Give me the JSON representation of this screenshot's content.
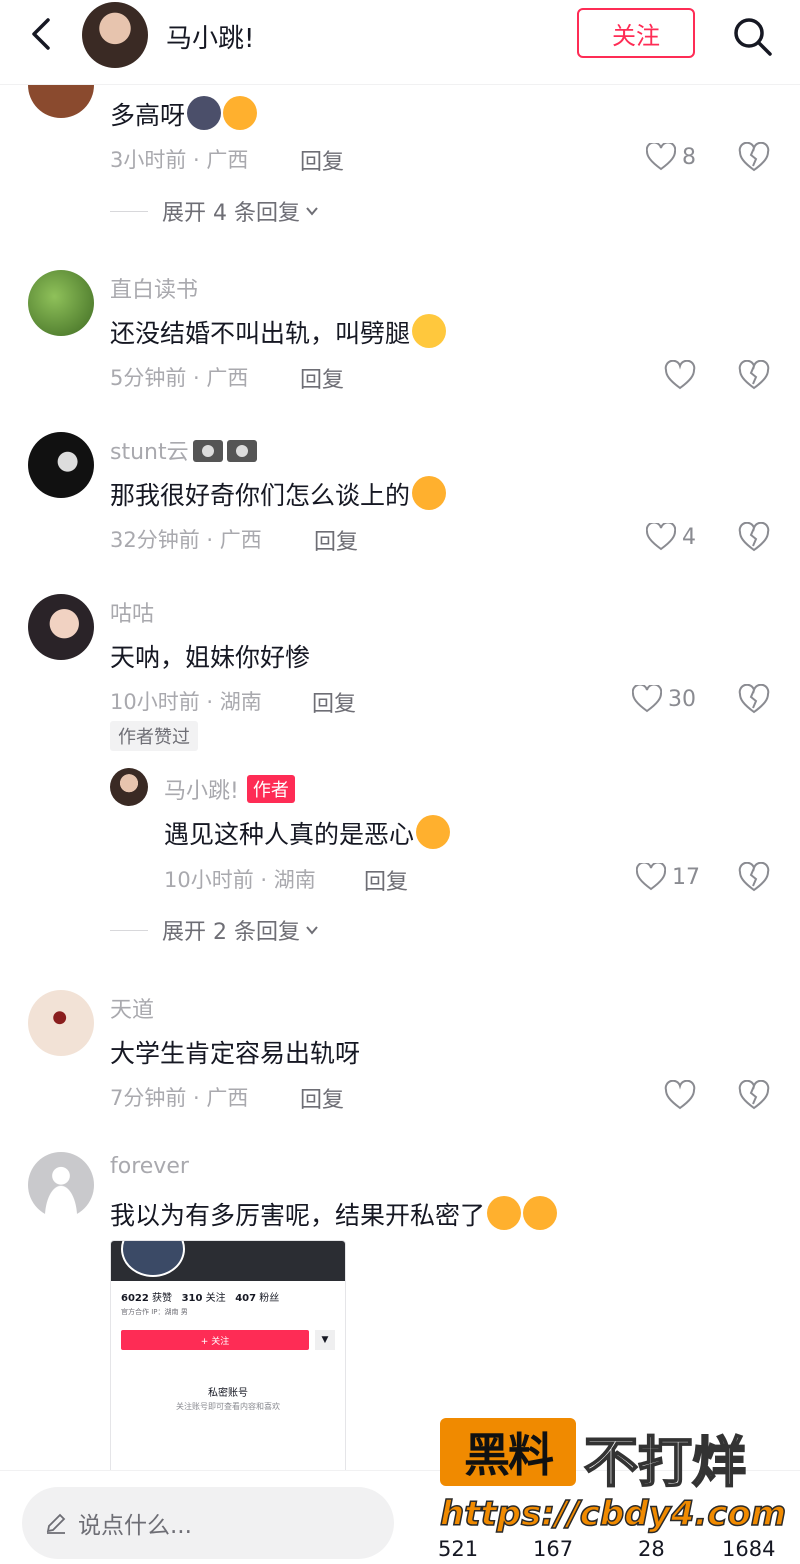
{
  "header": {
    "name": "马小跳!",
    "follow_label": "关注"
  },
  "comments": [
    {
      "text": "多高呀",
      "meta": "3小时前 · 广西",
      "reply": "回复",
      "likes": "8",
      "expand": "展开 4 条回复"
    },
    {
      "user": "直白读书",
      "text": "还没结婚不叫出轨，叫劈腿",
      "meta": "5分钟前 · 广西",
      "reply": "回复"
    },
    {
      "user": "stunt云",
      "text": "那我很好奇你们怎么谈上的",
      "meta": "32分钟前 · 广西",
      "reply": "回复",
      "likes": "4"
    },
    {
      "user": "咕咕",
      "text": "天呐，姐妹你好惨",
      "meta": "10小时前 · 湖南",
      "reply": "回复",
      "likes": "30",
      "badge": "作者赞过"
    },
    {
      "user": "马小跳!",
      "author_badge": "作者",
      "text": "遇见这种人真的是恶心",
      "meta": "10小时前 · 湖南",
      "reply": "回复",
      "likes": "17",
      "expand": "展开 2 条回复"
    },
    {
      "user": "天道",
      "text": "大学生肯定容易出轨呀",
      "meta": "7分钟前 · 广西",
      "reply": "回复"
    },
    {
      "user": "forever",
      "text": "我以为有多厉害呢，结果开私密了"
    }
  ],
  "thumb": {
    "stats": [
      "6022",
      "获赞",
      "310",
      "关注",
      "407",
      "粉丝"
    ],
    "tags": "官方合作  IP：湖南  男",
    "follow": "+ 关注",
    "dropdown": "▼",
    "private_title": "私密账号",
    "private_sub": "关注账号即可查看内容和喜欢"
  },
  "bottom": {
    "placeholder": "说点什么...",
    "stats": [
      "521",
      "167",
      "28",
      "1684"
    ]
  },
  "watermark": {
    "box": "黑料",
    "text": "不打烊",
    "url": "https://cbdy4.com"
  },
  "colors": {
    "accent": "#fe2c55",
    "watermark_orange": "#f08a00"
  }
}
